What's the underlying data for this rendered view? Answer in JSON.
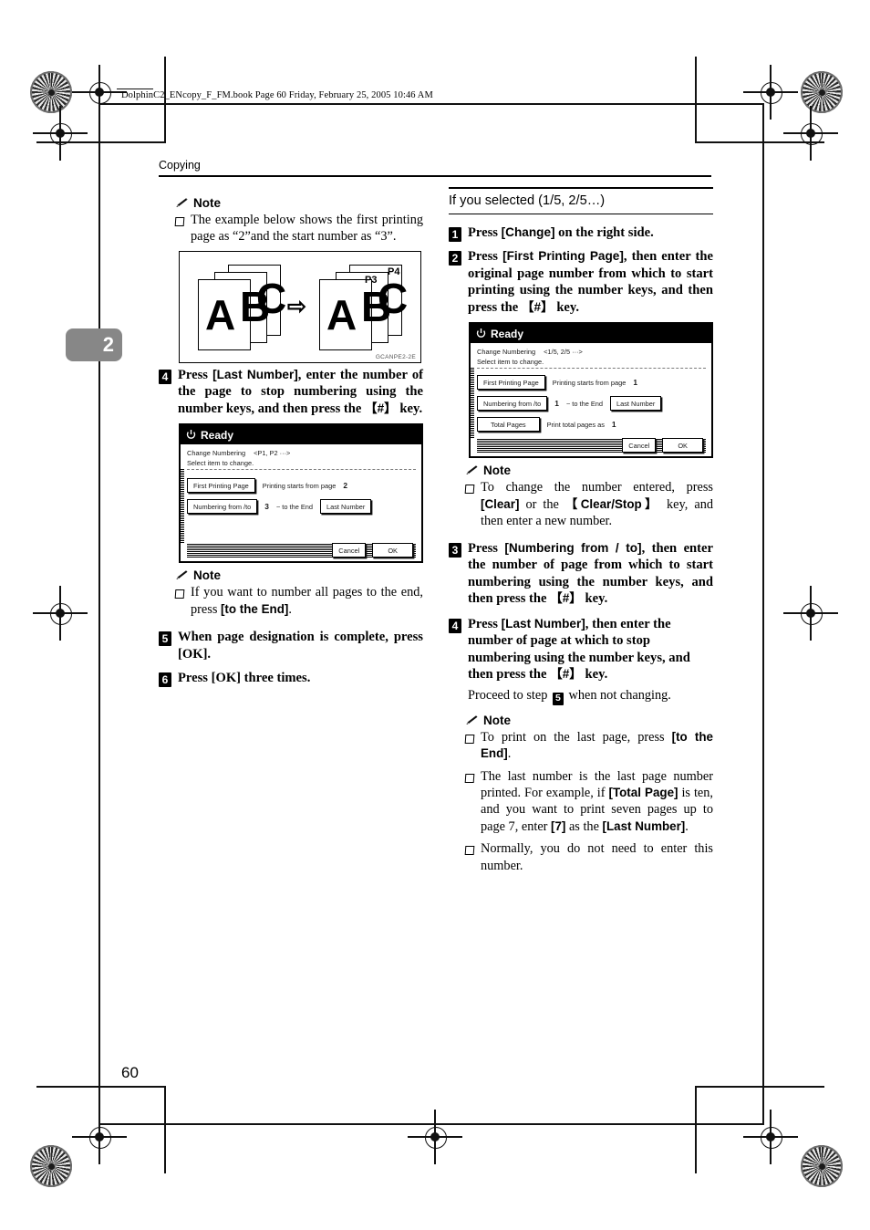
{
  "book_header": "DolphinC2_ENcopy_F_FM.book  Page 60  Friday, February 25, 2005  10:46 AM",
  "running_head": "Copying",
  "chapter_tab": "2",
  "folio": "60",
  "left_column": {
    "note1": {
      "label": "Note",
      "items": [
        "The example below shows the first printing page as “2”and the start number as “3”."
      ]
    },
    "figure": {
      "caption": "GCANPE2-2E",
      "left_stack_glyphs": [
        "A",
        "B",
        "C"
      ],
      "right_stack_glyphs": [
        "A",
        "B",
        "C"
      ],
      "right_stack_labels": [
        "P3",
        "P4"
      ],
      "arrow": "⇨"
    },
    "step4": {
      "number": "4",
      "text_parts": [
        {
          "t": "Press ",
          "s": "n"
        },
        {
          "t": "[Last Number]",
          "s": "ui"
        },
        {
          "t": ", enter the number of the page to stop numbering using the number keys, and then press the ",
          "s": "n"
        },
        {
          "t": "【#】",
          "s": "ui"
        },
        {
          "t": " key.",
          "s": "n"
        }
      ]
    },
    "lcd": {
      "title": "Ready",
      "heading": "Change Numbering",
      "range": "<P1, P2 ···>",
      "subtitle": "Select item to change.",
      "rows": [
        {
          "button": "First Printing Page",
          "label": "Printing starts from page",
          "value": "2"
        },
        {
          "button": "Numbering from /to",
          "value": "3",
          "label": "~ to the End",
          "button2": "Last Number"
        }
      ],
      "cancel": "Cancel",
      "ok": "OK"
    },
    "note2": {
      "label": "Note",
      "items": [
        {
          "parts": [
            {
              "t": "If you want to number all pages to the end, press ",
              "s": "n"
            },
            {
              "t": "[to the End]",
              "s": "ui"
            },
            {
              "t": ".",
              "s": "n"
            }
          ]
        }
      ]
    },
    "step5": {
      "number": "5",
      "text": "When page designation is complete, press [OK]."
    },
    "step6": {
      "number": "6",
      "text": "Press [OK] three times."
    }
  },
  "right_column": {
    "section_heading": "If you selected (1/5, 2/5…)",
    "step1": {
      "number": "1",
      "parts": [
        {
          "t": "Press ",
          "s": "n"
        },
        {
          "t": "[Change]",
          "s": "ui"
        },
        {
          "t": " on the right side.",
          "s": "n"
        }
      ]
    },
    "step2": {
      "number": "2",
      "parts": [
        {
          "t": "Press ",
          "s": "n"
        },
        {
          "t": "[First Printing Page]",
          "s": "ui"
        },
        {
          "t": ", then enter the original page number from which to start printing using the number keys, and then press the ",
          "s": "n"
        },
        {
          "t": "【#】",
          "s": "ui"
        },
        {
          "t": " key.",
          "s": "n"
        }
      ]
    },
    "lcd": {
      "title": "Ready",
      "heading": "Change Numbering",
      "range": "<1/5, 2/5 ···>",
      "subtitle": "Select item to change.",
      "rows": [
        {
          "button": "First Printing Page",
          "label": "Printing starts from page",
          "value": "1"
        },
        {
          "button": "Numbering from /to",
          "value": "1",
          "label": "~ to the End",
          "button2": "Last Number"
        },
        {
          "button": "Total Pages",
          "label": "Print total pages as",
          "value": "1"
        }
      ],
      "cancel": "Cancel",
      "ok": "OK"
    },
    "note1": {
      "label": "Note",
      "items": [
        {
          "parts": [
            {
              "t": "To change the number entered, press ",
              "s": "n"
            },
            {
              "t": "[Clear]",
              "s": "ui"
            },
            {
              "t": " or the ",
              "s": "n"
            },
            {
              "t": "【Clear/Stop】",
              "s": "ui"
            },
            {
              "t": " key, and then enter a new number.",
              "s": "n"
            }
          ]
        }
      ]
    },
    "step3": {
      "number": "3",
      "parts": [
        {
          "t": "Press ",
          "s": "n"
        },
        {
          "t": "[Numbering from / to]",
          "s": "ui"
        },
        {
          "t": ", then enter the number of page from which to start numbering using the number keys, and then press the ",
          "s": "n"
        },
        {
          "t": "【#】",
          "s": "ui"
        },
        {
          "t": " key.",
          "s": "n"
        }
      ]
    },
    "step4": {
      "number": "4",
      "parts": [
        {
          "t": "Press ",
          "s": "n"
        },
        {
          "t": "[Last Number]",
          "s": "ui"
        },
        {
          "t": ", then enter the number of page at which to stop numbering using the number keys, and then press the ",
          "s": "n"
        },
        {
          "t": "【#】",
          "s": "ui"
        },
        {
          "t": " key.",
          "s": "n"
        }
      ],
      "followup_pre": "Proceed to step ",
      "followup_step": "5",
      "followup_post": " when not changing."
    },
    "note2": {
      "label": "Note",
      "items": [
        {
          "parts": [
            {
              "t": "To print on the last page, press ",
              "s": "n"
            },
            {
              "t": "[to the End]",
              "s": "ui"
            },
            {
              "t": ".",
              "s": "n"
            }
          ]
        },
        {
          "parts": [
            {
              "t": "The last number is the last page number printed. For example, if ",
              "s": "n"
            },
            {
              "t": "[Total Page]",
              "s": "ui"
            },
            {
              "t": " is ten, and you want to print seven pages up to page 7, enter ",
              "s": "n"
            },
            {
              "t": "[7]",
              "s": "ui"
            },
            {
              "t": " as the ",
              "s": "n"
            },
            {
              "t": "[Last Number]",
              "s": "ui"
            },
            {
              "t": ".",
              "s": "n"
            }
          ]
        },
        {
          "parts": [
            {
              "t": "Normally, you do not need to enter this number.",
              "s": "n"
            }
          ]
        }
      ]
    }
  }
}
